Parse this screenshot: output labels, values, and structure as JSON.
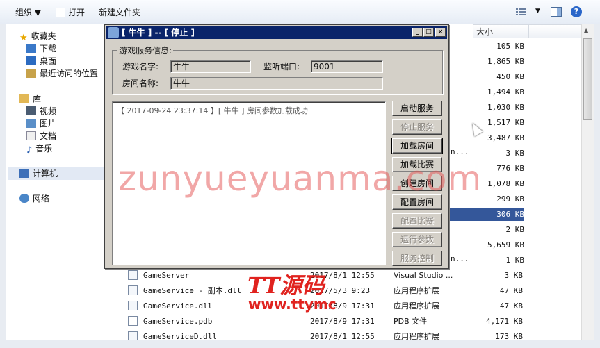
{
  "toolbar": {
    "organize": "组织 ▼",
    "open": "打开",
    "new_folder": "新建文件夹",
    "help": "?"
  },
  "nav": {
    "favorites": "收藏夹",
    "downloads": "下载",
    "desktop": "桌面",
    "recent": "最近访问的位置",
    "libraries": "库",
    "videos": "视频",
    "pictures": "图片",
    "documents": "文档",
    "music": "音乐",
    "computer": "计算机",
    "network": "网络"
  },
  "list": {
    "col_size": "大小",
    "sizes": [
      "105 KB",
      "1,865 KB",
      "450 KB",
      "1,494 KB",
      "1,030 KB",
      "1,517 KB",
      "3,487 KB",
      "3 KB",
      "776 KB",
      "1,078 KB",
      "299 KB",
      "306 KB",
      "2 KB",
      "5,659 KB",
      "1 KB"
    ],
    "truncated": [
      "n...",
      "n..."
    ],
    "files": [
      {
        "name": "GameServer",
        "date": "2017/8/1 12:55",
        "type": "Visual Studio ...",
        "size": "3 KB"
      },
      {
        "name": "GameService - 副本.dll",
        "date": "2017/5/3 9:23",
        "type": "应用程序扩展",
        "size": "47 KB"
      },
      {
        "name": "GameService.dll",
        "date": "2017/8/9 17:31",
        "type": "应用程序扩展",
        "size": "47 KB"
      },
      {
        "name": "GameService.pdb",
        "date": "2017/8/9 17:31",
        "type": "PDB 文件",
        "size": "4,171 KB"
      },
      {
        "name": "GameServiceD.dll",
        "date": "2017/8/1 12:55",
        "type": "应用程序扩展",
        "size": "173 KB"
      }
    ]
  },
  "dialog": {
    "title": "[ 牛牛 ] -- [ 停止 ]",
    "group_label": "游戏服务信息:",
    "game_name_label": "游戏名字:",
    "game_name_value": "牛牛",
    "port_label": "监听端口:",
    "port_value": "9001",
    "room_name_label": "房间名称:",
    "room_name_value": "牛牛",
    "log_line": "【 2017-09-24 23:37:14 】[ 牛牛 ] 房间参数加载成功",
    "buttons": {
      "start": "启动服务",
      "stop": "停止服务",
      "load_room": "加载房间",
      "load_match": "加载比赛",
      "create_room": "创建房间",
      "config_room": "配置房间",
      "config_match": "配置比赛",
      "run_params": "运行参数",
      "service_control": "服务控制"
    }
  },
  "watermark": {
    "main": "zunyueyuanma.com",
    "logo": "TT源码",
    "url": "www.ttymc"
  }
}
